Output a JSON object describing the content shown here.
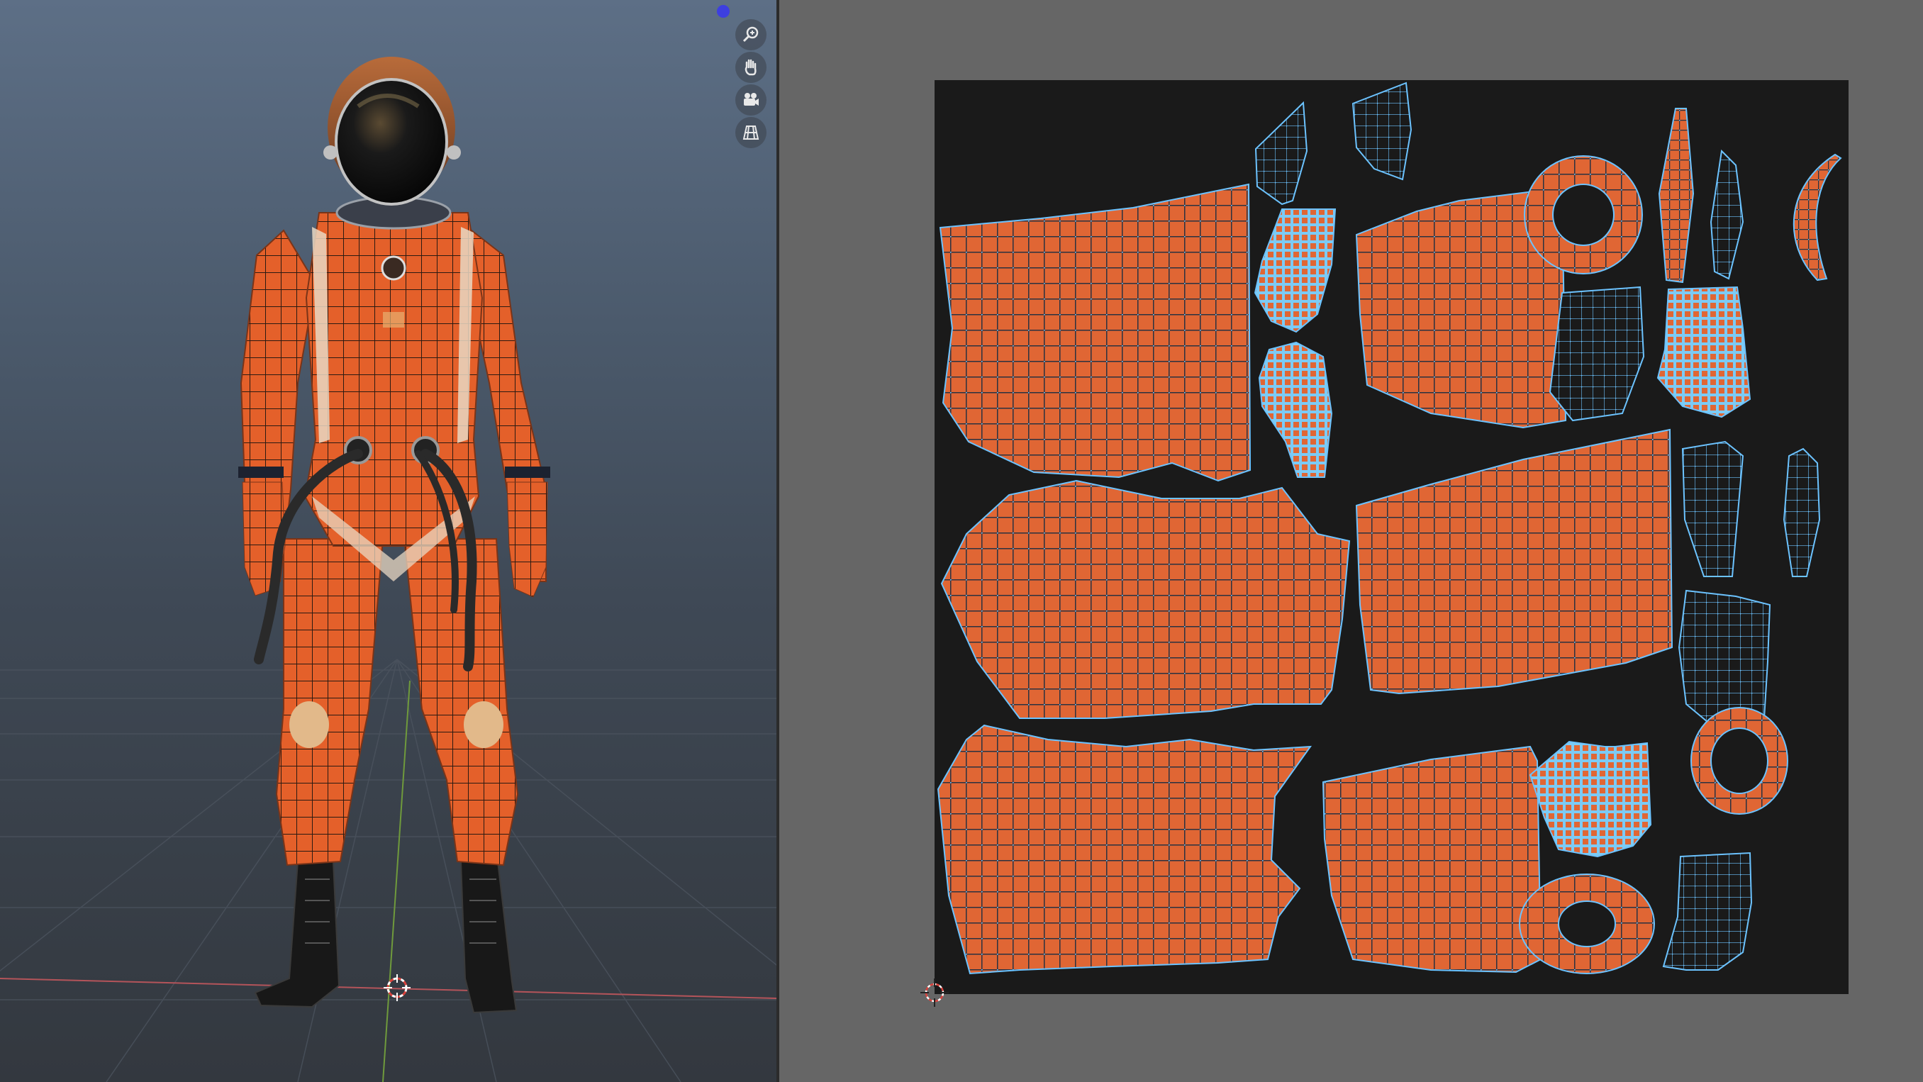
{
  "viewport3d": {
    "background_top": "#5d6f86",
    "background_bottom": "#33383f",
    "gizmo_color": "#3d3fe0",
    "navigation": [
      {
        "icon": "zoom-icon"
      },
      {
        "icon": "pan-hand-icon"
      },
      {
        "icon": "camera-icon"
      },
      {
        "icon": "perspective-grid-icon"
      }
    ],
    "model": {
      "suit_color": "#e4602a",
      "wire_color": "#1e1a18",
      "visor_color": "#0c0c0c",
      "boots_color": "#171717"
    }
  },
  "uv_editor": {
    "canvas_color": "#1a1a1a",
    "island_fill": "#e06634",
    "island_edge": "#2a3140",
    "vertex_color": "#6cc3ff",
    "glove_fill": "#7ccbf5"
  }
}
